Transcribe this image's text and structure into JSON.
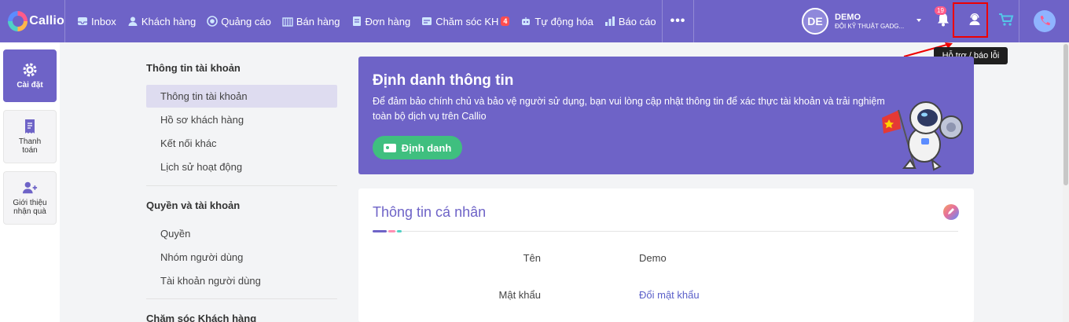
{
  "app": {
    "logo_text": "Callio"
  },
  "nav": {
    "items": [
      {
        "label": "Inbox",
        "icon": "inbox-icon"
      },
      {
        "label": "Khách hàng",
        "icon": "customers-icon"
      },
      {
        "label": "Quảng cáo",
        "icon": "ads-icon"
      },
      {
        "label": "Bán hàng",
        "icon": "sales-icon"
      },
      {
        "label": "Đơn hàng",
        "icon": "orders-icon"
      },
      {
        "label": "Chăm sóc KH",
        "icon": "care-icon",
        "badge": "4"
      },
      {
        "label": "Tự động hóa",
        "icon": "automation-icon"
      },
      {
        "label": "Báo cáo",
        "icon": "report-icon"
      }
    ],
    "more": "•••"
  },
  "user": {
    "initials": "DE",
    "name": "DEMO",
    "org": "ĐỘI KỸ THUẬT GADG..."
  },
  "notifications": {
    "count": "19"
  },
  "tooltip": {
    "text": "Hỗ trợ / báo lỗi"
  },
  "rail": {
    "items": [
      {
        "label": "Cài đặt",
        "icon": "gear-icon"
      },
      {
        "label": "Thanh toán",
        "icon": "receipt-icon"
      },
      {
        "label": "Giới thiệu nhận quà",
        "icon": "add-user-icon"
      }
    ]
  },
  "menu": {
    "sections": [
      {
        "title": "Thông tin tài khoản",
        "items": [
          "Thông tin tài khoản",
          "Hồ sơ khách hàng",
          "Kết nối khác",
          "Lịch sử hoạt động"
        ]
      },
      {
        "title": "Quyền và tài khoản",
        "items": [
          "Quyền",
          "Nhóm người dùng",
          "Tài khoản người dùng"
        ]
      },
      {
        "title": "Chăm sóc Khách hàng",
        "items": []
      }
    ],
    "active_item": "Thông tin tài khoản"
  },
  "banner": {
    "title": "Định danh thông tin",
    "description": "Để đảm bảo chính chủ và bảo vệ người sử dụng, bạn vui lòng cập nhật thông tin để xác thực tài khoản và trải nghiệm toàn bộ dịch vụ trên Callio",
    "button": "Định danh"
  },
  "personal": {
    "title": "Thông tin cá nhân",
    "fields": [
      {
        "label": "Tên",
        "value": "Demo"
      },
      {
        "label": "Mật khẩu",
        "value": "Đổi mật khẩu"
      }
    ]
  },
  "colors": {
    "brand": "#6e63c7",
    "success": "#3fbf7f",
    "alert": "#ff4d4f",
    "highlight_box": "#ee0000"
  }
}
